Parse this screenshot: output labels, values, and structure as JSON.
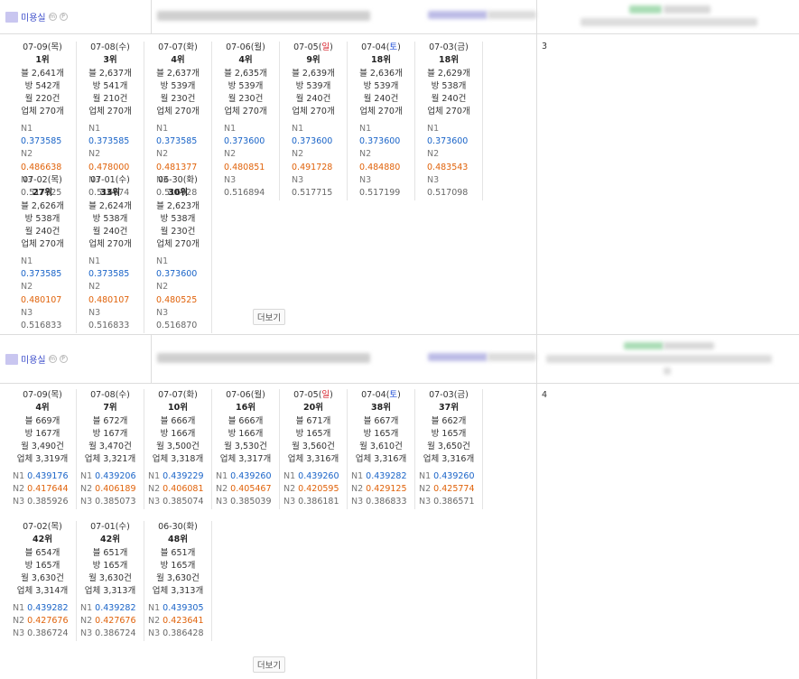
{
  "sections": [
    {
      "category_label": "미용실",
      "side_number": "3",
      "more_label": "더보기",
      "cards": [
        {
          "date": "07-09",
          "dow": "목",
          "dow_type": "",
          "rank": "1위",
          "blog": "블 2,641개",
          "bang": "방 542개",
          "month": "월 220건",
          "biz": "업체 270개",
          "n1": "0.373585",
          "n2": "0.486638",
          "n3": "0.517325"
        },
        {
          "date": "07-08",
          "dow": "수",
          "dow_type": "",
          "rank": "3위",
          "blog": "블 2,637개",
          "bang": "방 541개",
          "month": "월 210건",
          "biz": "업체 270개",
          "n1": "0.373585",
          "n2": "0.478000",
          "n3": "0.516674"
        },
        {
          "date": "07-07",
          "dow": "화",
          "dow_type": "",
          "rank": "4위",
          "blog": "블 2,637개",
          "bang": "방 539개",
          "month": "월 230건",
          "biz": "업체 270개",
          "n1": "0.373585",
          "n2": "0.481377",
          "n3": "0.516928"
        },
        {
          "date": "07-06",
          "dow": "월",
          "dow_type": "",
          "rank": "4위",
          "blog": "블 2,635개",
          "bang": "방 539개",
          "month": "월 230건",
          "biz": "업체 270개",
          "n1": "0.373600",
          "n2": "0.480851",
          "n3": "0.516894"
        },
        {
          "date": "07-05",
          "dow": "일",
          "dow_type": "sun",
          "rank": "9위",
          "blog": "블 2,639개",
          "bang": "방 539개",
          "month": "월 240건",
          "biz": "업체 270개",
          "n1": "0.373600",
          "n2": "0.491728",
          "n3": "0.517715"
        },
        {
          "date": "07-04",
          "dow": "토",
          "dow_type": "sat",
          "rank": "18위",
          "blog": "블 2,636개",
          "bang": "방 539개",
          "month": "월 240건",
          "biz": "업체 270개",
          "n1": "0.373600",
          "n2": "0.484880",
          "n3": "0.517199"
        },
        {
          "date": "07-03",
          "dow": "금",
          "dow_type": "",
          "rank": "18위",
          "blog": "블 2,629개",
          "bang": "방 538개",
          "month": "월 240건",
          "biz": "업체 270개",
          "n1": "0.373600",
          "n2": "0.483543",
          "n3": "0.517098"
        },
        {
          "date": "07-02",
          "dow": "목",
          "dow_type": "",
          "rank": "27위",
          "blog": "블 2,626개",
          "bang": "방 538개",
          "month": "월 240건",
          "biz": "업체 270개",
          "n1": "0.373585",
          "n2": "0.480107",
          "n3": "0.516833"
        },
        {
          "date": "07-01",
          "dow": "수",
          "dow_type": "",
          "rank": "33위",
          "blog": "블 2,624개",
          "bang": "방 538개",
          "month": "월 240건",
          "biz": "업체 270개",
          "n1": "0.373585",
          "n2": "0.480107",
          "n3": "0.516833"
        },
        {
          "date": "06-30",
          "dow": "화",
          "dow_type": "",
          "rank": "30위",
          "blog": "블 2,623개",
          "bang": "방 538개",
          "month": "월 230건",
          "biz": "업체 270개",
          "n1": "0.373600",
          "n2": "0.480525",
          "n3": "0.516870"
        }
      ]
    },
    {
      "category_label": "미용실",
      "side_number": "4",
      "more_label": "더보기",
      "cards": [
        {
          "date": "07-09",
          "dow": "목",
          "dow_type": "",
          "rank": "4위",
          "blog": "블 669개",
          "bang": "방 167개",
          "month": "월 3,490건",
          "biz": "업체 3,319개",
          "n1": "0.439176",
          "n2": "0.417644",
          "n3": "0.385926"
        },
        {
          "date": "07-08",
          "dow": "수",
          "dow_type": "",
          "rank": "7위",
          "blog": "블 672개",
          "bang": "방 167개",
          "month": "월 3,470건",
          "biz": "업체 3,321개",
          "n1": "0.439206",
          "n2": "0.406189",
          "n3": "0.385073"
        },
        {
          "date": "07-07",
          "dow": "화",
          "dow_type": "",
          "rank": "10위",
          "blog": "블 666개",
          "bang": "방 166개",
          "month": "월 3,500건",
          "biz": "업체 3,318개",
          "n1": "0.439229",
          "n2": "0.406081",
          "n3": "0.385074"
        },
        {
          "date": "07-06",
          "dow": "월",
          "dow_type": "",
          "rank": "16위",
          "blog": "블 666개",
          "bang": "방 166개",
          "month": "월 3,530건",
          "biz": "업체 3,317개",
          "n1": "0.439260",
          "n2": "0.405467",
          "n3": "0.385039"
        },
        {
          "date": "07-05",
          "dow": "일",
          "dow_type": "sun",
          "rank": "20위",
          "blog": "블 671개",
          "bang": "방 165개",
          "month": "월 3,560건",
          "biz": "업체 3,316개",
          "n1": "0.439260",
          "n2": "0.420595",
          "n3": "0.386181"
        },
        {
          "date": "07-04",
          "dow": "토",
          "dow_type": "sat",
          "rank": "38위",
          "blog": "블 667개",
          "bang": "방 165개",
          "month": "월 3,610건",
          "biz": "업체 3,316개",
          "n1": "0.439282",
          "n2": "0.429125",
          "n3": "0.386833"
        },
        {
          "date": "07-03",
          "dow": "금",
          "dow_type": "",
          "rank": "37위",
          "blog": "블 662개",
          "bang": "방 165개",
          "month": "월 3,650건",
          "biz": "업체 3,316개",
          "n1": "0.439260",
          "n2": "0.425774",
          "n3": "0.386571"
        },
        {
          "date": "07-02",
          "dow": "목",
          "dow_type": "",
          "rank": "42위",
          "blog": "블 654개",
          "bang": "방 165개",
          "month": "월 3,630건",
          "biz": "업체 3,314개",
          "n1": "0.439282",
          "n2": "0.427676",
          "n3": "0.386724"
        },
        {
          "date": "07-01",
          "dow": "수",
          "dow_type": "",
          "rank": "42위",
          "blog": "블 651개",
          "bang": "방 165개",
          "month": "월 3,630건",
          "biz": "업체 3,313개",
          "n1": "0.439282",
          "n2": "0.427676",
          "n3": "0.386724"
        },
        {
          "date": "06-30",
          "dow": "화",
          "dow_type": "",
          "rank": "48위",
          "blog": "블 651개",
          "bang": "방 165개",
          "month": "월 3,630건",
          "biz": "업체 3,313개",
          "n1": "0.439305",
          "n2": "0.423641",
          "n3": "0.386428"
        }
      ]
    }
  ]
}
